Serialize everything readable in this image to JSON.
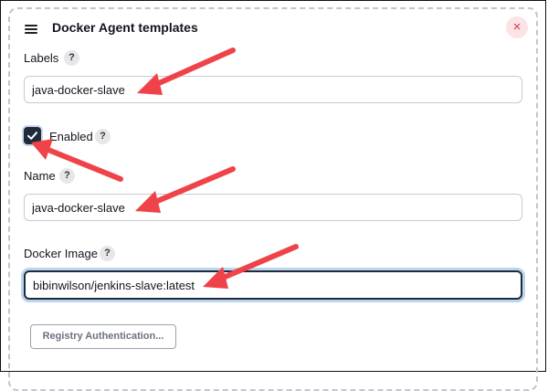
{
  "panel": {
    "title": "Docker Agent templates",
    "close_glyph": "×"
  },
  "labels_section": {
    "label": "Labels",
    "help_glyph": "?",
    "value": "java-docker-slave"
  },
  "enabled_section": {
    "label": "Enabled",
    "help_glyph": "?",
    "checked": true
  },
  "name_section": {
    "label": "Name",
    "help_glyph": "?",
    "value": "java-docker-slave"
  },
  "image_section": {
    "label": "Docker Image",
    "help_glyph": "?",
    "value": "bibinwilson/jenkins-slave:latest"
  },
  "registry_button": {
    "label": "Registry Authentication..."
  },
  "colors": {
    "accent": "#1d2b3b",
    "annotation_arrow": "#ef4249",
    "close": "#e0334a"
  }
}
